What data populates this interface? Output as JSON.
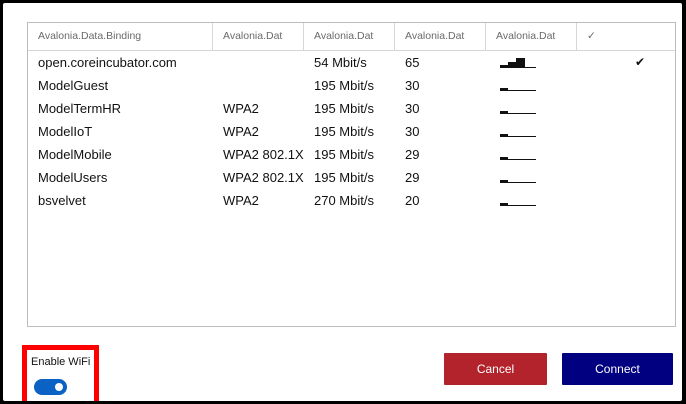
{
  "grid": {
    "headers": [
      "Avalonia.Data.Binding",
      "Avalonia.Dat",
      "Avalonia.Dat",
      "Avalonia.Dat",
      "Avalonia.Dat",
      "✓"
    ],
    "rows": [
      {
        "name": "open.coreincubator.com",
        "security": "",
        "speed": "54 Mbit/s",
        "strength": "65",
        "signal_level": 1.0,
        "connected": "✔"
      },
      {
        "name": "ModelGuest",
        "security": "",
        "speed": "195 Mbit/s",
        "strength": "30",
        "signal_level": 0.25,
        "connected": ""
      },
      {
        "name": "ModelTermHR",
        "security": "WPA2",
        "speed": "195 Mbit/s",
        "strength": "30",
        "signal_level": 0.25,
        "connected": ""
      },
      {
        "name": "ModelIoT",
        "security": "WPA2",
        "speed": "195 Mbit/s",
        "strength": "30",
        "signal_level": 0.25,
        "connected": ""
      },
      {
        "name": "ModelMobile",
        "security": "WPA2 802.1X",
        "speed": "195 Mbit/s",
        "strength": "29",
        "signal_level": 0.25,
        "connected": ""
      },
      {
        "name": "ModelUsers",
        "security": "WPA2 802.1X",
        "speed": "195 Mbit/s",
        "strength": "29",
        "signal_level": 0.25,
        "connected": ""
      },
      {
        "name": "bsvelvet",
        "security": "WPA2",
        "speed": "270 Mbit/s",
        "strength": "20",
        "signal_level": 0.25,
        "connected": ""
      }
    ]
  },
  "wifi": {
    "label": "Enable WiFi",
    "enabled": true
  },
  "buttons": {
    "cancel": "Cancel",
    "connect": "Connect"
  },
  "colors": {
    "cancel": "#b3232b",
    "connect": "#000080",
    "toggle": "#0a62c4",
    "highlight": "#ff0000"
  }
}
